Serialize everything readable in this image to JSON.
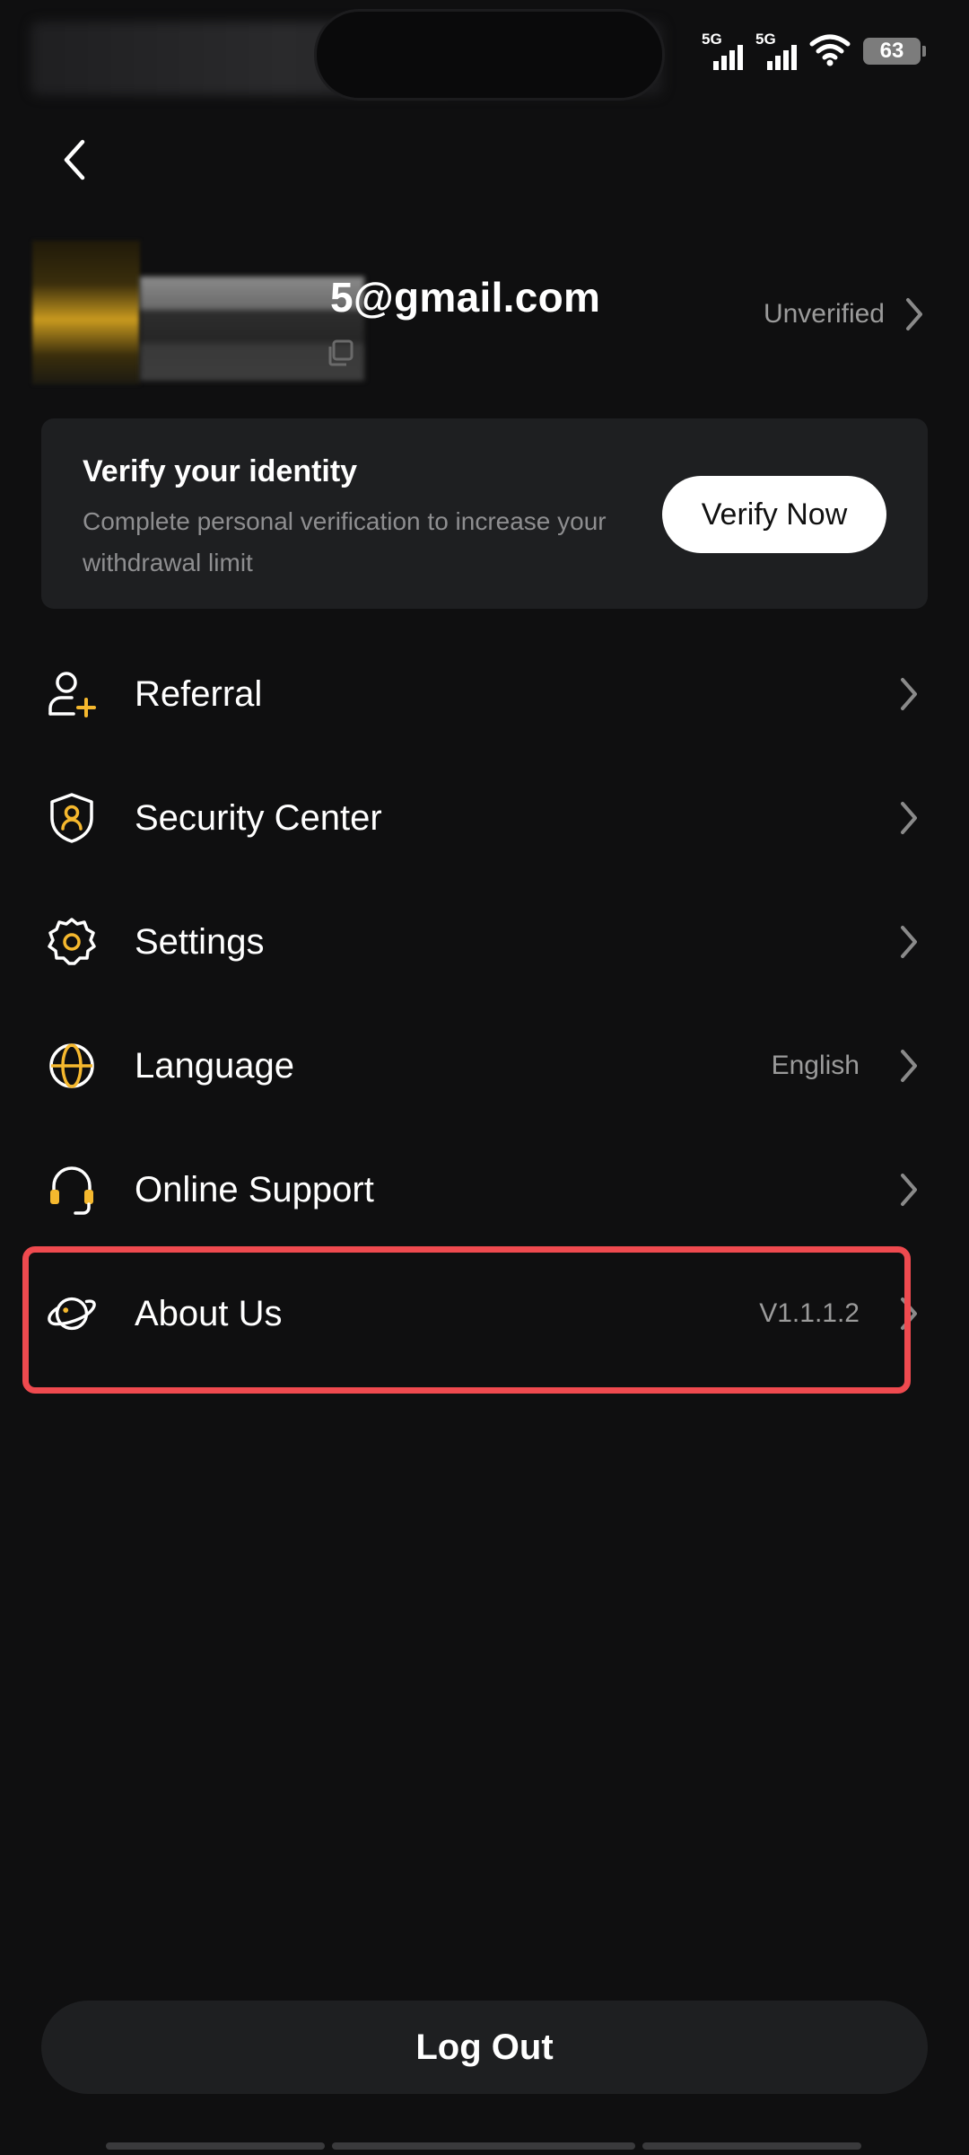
{
  "status_bar": {
    "network_1": "5G",
    "network_2": "5G",
    "battery": "63",
    "icons": [
      "signal-icon",
      "signal-icon",
      "wifi-icon",
      "battery-icon"
    ]
  },
  "header": {
    "back_icon": "chevron-left-icon"
  },
  "profile": {
    "email": "5@gmail.com",
    "verification_status": "Unverified",
    "copy_icon": "copy-icon"
  },
  "verify_card": {
    "title": "Verify your identity",
    "description": "Complete personal verification to increase your withdrawal limit",
    "button_label": "Verify Now"
  },
  "menu": {
    "items": [
      {
        "label": "Referral",
        "value": "",
        "icon": "add-user-icon"
      },
      {
        "label": "Security Center",
        "value": "",
        "icon": "shield-user-icon"
      },
      {
        "label": "Settings",
        "value": "",
        "icon": "gear-icon"
      },
      {
        "label": "Language",
        "value": "English",
        "icon": "globe-icon"
      },
      {
        "label": "Online Support",
        "value": "",
        "icon": "headset-icon"
      },
      {
        "label": "About Us",
        "value": "V1.1.1.2",
        "icon": "planet-icon"
      }
    ]
  },
  "footer": {
    "logout_label": "Log Out"
  },
  "colors": {
    "background": "#0f0f10",
    "card": "#1e1f21",
    "accent": "#f5b82e",
    "highlight": "#ef4a4f",
    "muted_text": "#9b9b9b"
  }
}
